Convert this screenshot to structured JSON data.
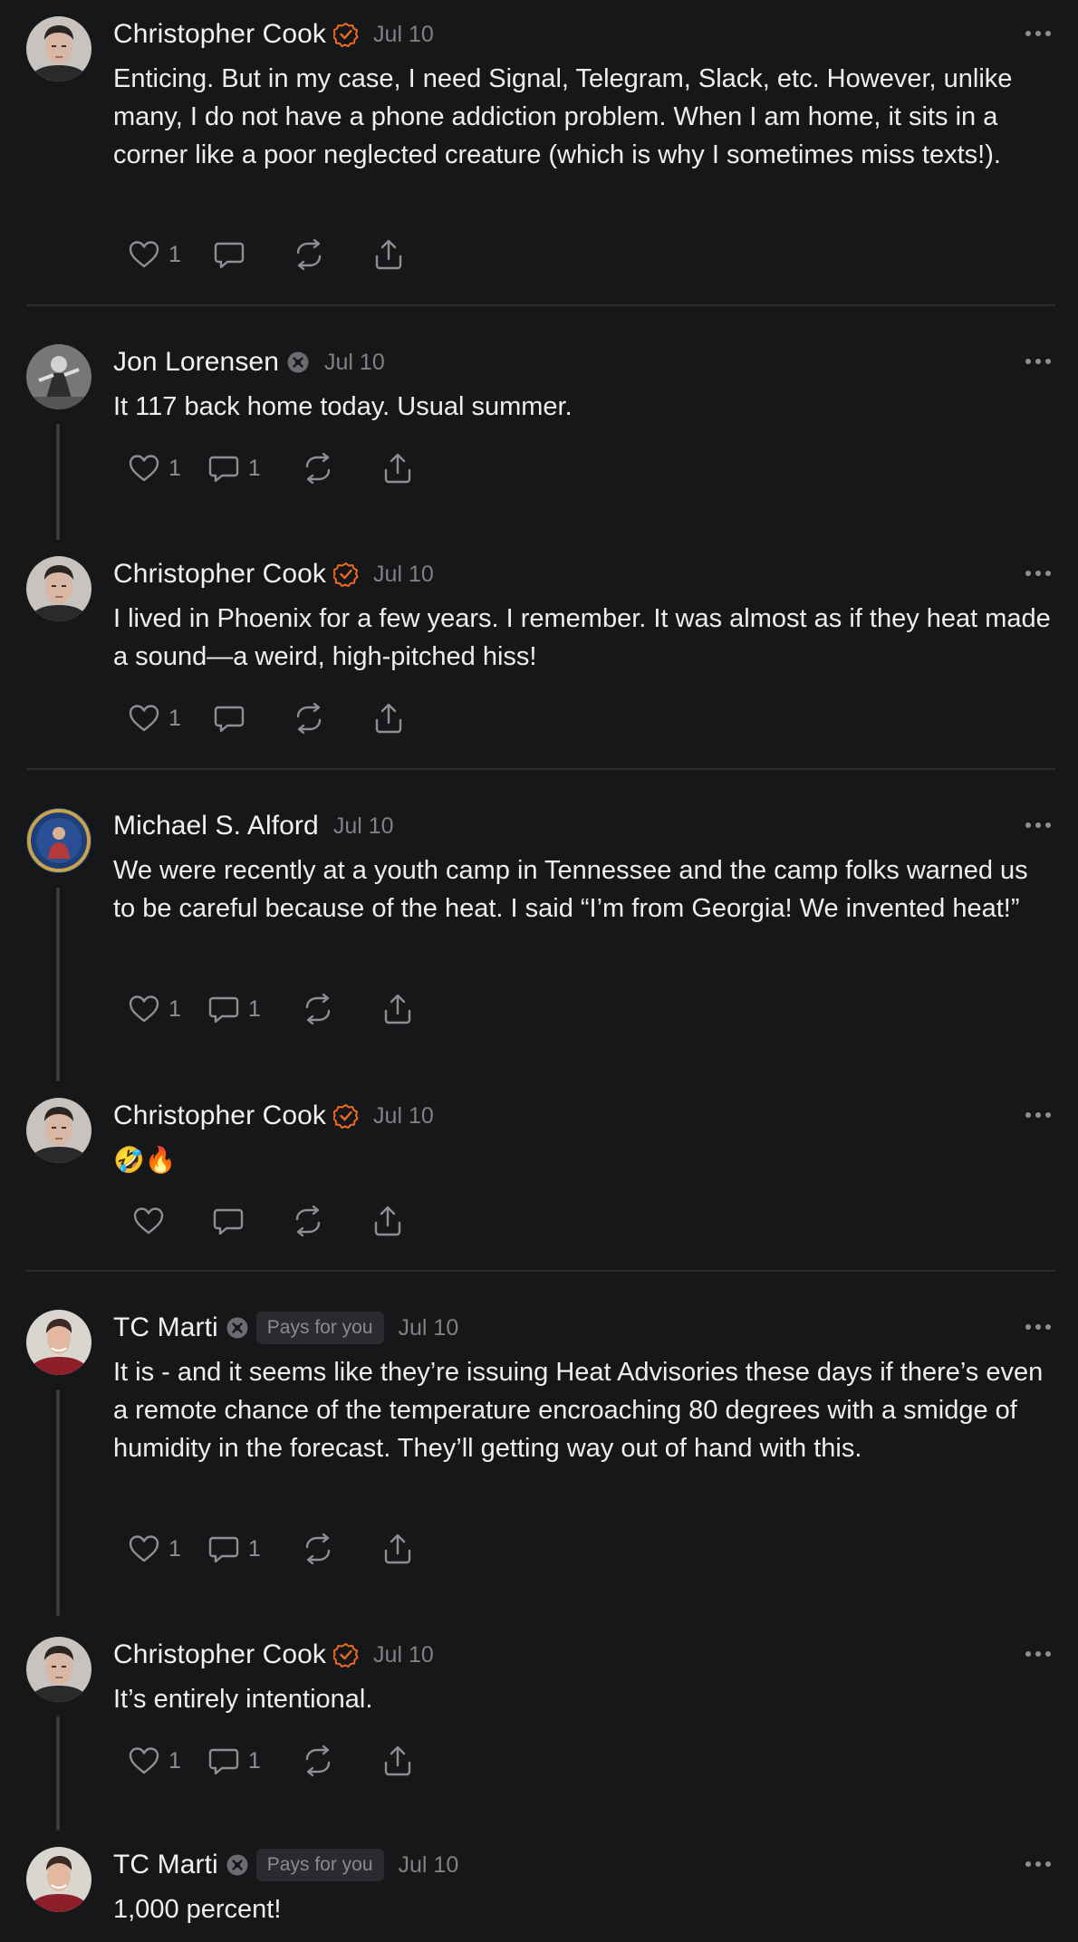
{
  "theme": {
    "background": "#161719",
    "accent": "#f06a1f",
    "muted": "#808185"
  },
  "posts": [
    {
      "author": "Christopher Cook",
      "verified": true,
      "date": "Jul 10",
      "text": "Enticing. But in my case, I need Signal, Telegram, Slack, etc. However, unlike many, I do not have a phone addiction problem. When I am home, it sits in a corner like a poor neglected creature (which is why I sometimes miss texts!).",
      "likes": "1",
      "replies": ""
    },
    {
      "author": "Jon Lorensen",
      "verified": false,
      "date": "Jul 10",
      "text": "It 117 back home today. Usual summer.",
      "likes": "1",
      "replies": "1"
    },
    {
      "author": "Christopher Cook",
      "verified": true,
      "date": "Jul 10",
      "text": "I lived in Phoenix for a few years. I remember. It was almost as if they heat made a sound—a weird, high-pitched hiss!",
      "likes": "1",
      "replies": ""
    },
    {
      "author": "Michael S. Alford",
      "verified": false,
      "date": "Jul 10",
      "text": "We were recently at a youth camp in Tennessee and the camp folks warned us to be careful because of the heat. I said “I’m from Georgia! We invented heat!”",
      "likes": "1",
      "replies": "1"
    },
    {
      "author": "Christopher Cook",
      "verified": true,
      "date": "Jul 10",
      "text": "🤣🔥",
      "likes": "",
      "replies": ""
    },
    {
      "author": "TC Marti",
      "verified": false,
      "tag": "Pays for you",
      "date": "Jul 10",
      "text": "It is - and it seems like they’re issuing Heat Advisories these days if there’s even a remote chance of the temperature encroaching 80 degrees with a smidge of humidity in the forecast. They’ll getting way out of hand with this.",
      "likes": "1",
      "replies": "1"
    },
    {
      "author": "Christopher Cook",
      "verified": true,
      "date": "Jul 10",
      "text": "It’s entirely intentional.",
      "likes": "1",
      "replies": "1"
    },
    {
      "author": "TC Marti",
      "verified": false,
      "tag": "Pays for you",
      "date": "Jul 10",
      "text": "1,000 percent!",
      "likes": "",
      "replies": ""
    }
  ],
  "icons": {
    "like": "heart-icon",
    "reply": "comment-icon",
    "restack": "restack-icon",
    "share": "share-icon",
    "more": "more-icon",
    "verified": "verified-check-icon",
    "muted_badge": "badge-icon"
  }
}
